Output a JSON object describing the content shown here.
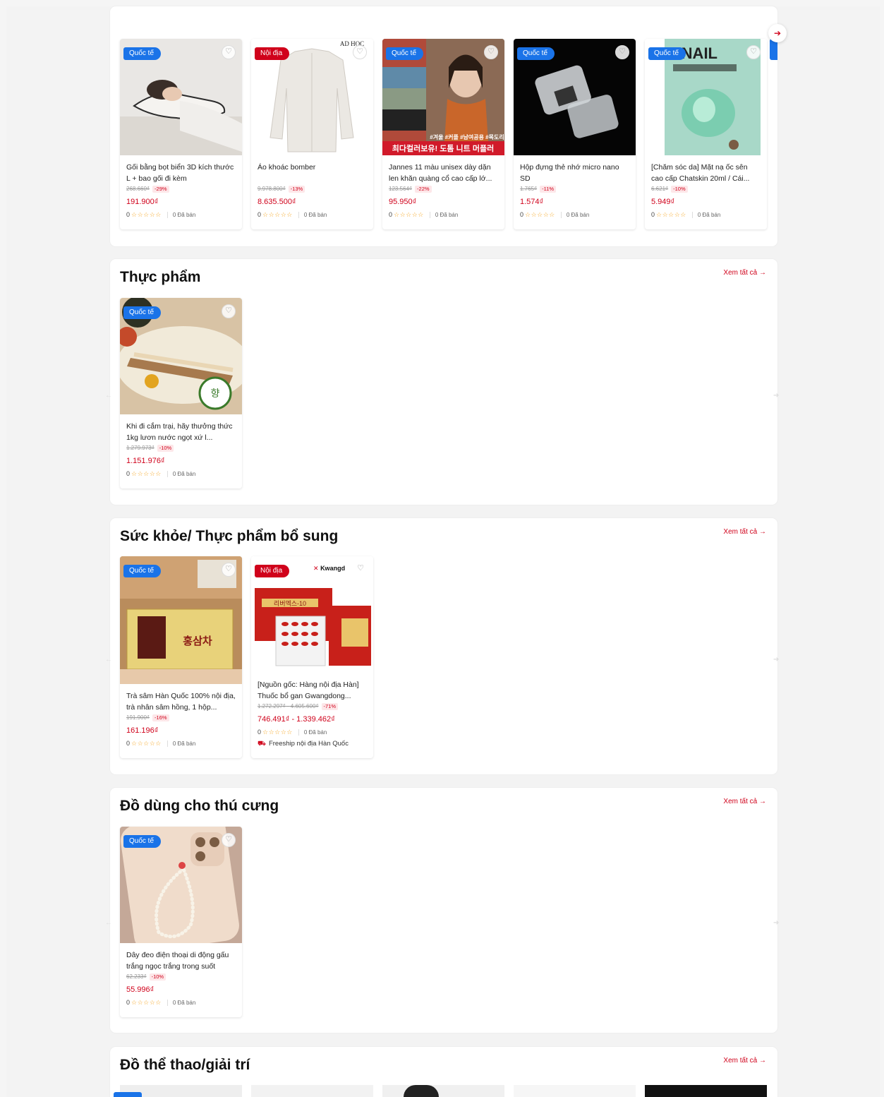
{
  "common": {
    "sold_label": "0 Đã bán",
    "rating_count": "0",
    "stars": "☆☆☆☆☆",
    "view_all": "Xem tất cả →",
    "badge_intl": "Quốc tế",
    "badge_local": "Nội địa",
    "next_arrow": "➔",
    "prev_arrow": "←",
    "heart_icon": "♡"
  },
  "top_section": {
    "products": [
      {
        "name": "Gối bằng bọt biển 3D kích thước L + bao gối đi kèm",
        "old_price": "268.660₫",
        "discount": "-29%",
        "price": "191.900₫",
        "badge": "Quốc tế"
      },
      {
        "name": "Áo khoác bomber",
        "old_price": "9.978.800₫",
        "discount": "-13%",
        "price": "8.635.500₫",
        "badge": "Nội địa"
      },
      {
        "name": "Jannes 11 màu unisex dày dặn len khăn quàng cổ cao cấp lớ...",
        "old_price": "123.564₫",
        "discount": "-22%",
        "price": "95.950₫",
        "badge": "Quốc tế"
      },
      {
        "name": "Hộp đựng thẻ nhớ micro nano SD",
        "old_price": "1.765₫",
        "discount": "-11%",
        "price": "1.574₫",
        "badge": "Quốc tế"
      },
      {
        "name": "[Chăm sóc da] Mặt nạ ốc sên cao cấp Chatskin 20ml / Cái...",
        "old_price": "6.621₫",
        "discount": "-10%",
        "price": "5.949₫",
        "badge": "Quốc tế"
      }
    ]
  },
  "food_section": {
    "title": "Thực phẩm",
    "products": [
      {
        "name": "Khi đi cắm trại, hãy thưởng thức 1kg lươn nước ngọt xứ l...",
        "old_price": "1.279.973₫",
        "discount": "-10%",
        "price": "1.151.976₫",
        "badge": "Quốc tế"
      }
    ]
  },
  "health_section": {
    "title": "Sức khỏe/ Thực phẩm bổ sung",
    "products": [
      {
        "name": "Trà sâm Hàn Quốc 100% nội địa, trà nhân sâm hồng, 1 hộp...",
        "old_price": "191.900₫",
        "discount": "-16%",
        "price": "161.196₫",
        "badge": "Quốc tế"
      },
      {
        "name": "[Nguồn gốc: Hàng nội địa Hàn] Thuốc bổ gan Gwangdong...",
        "old_price": "1.272.297₫ - 4.605.600₫",
        "discount": "-71%",
        "price": "746.491₫ - 1.339.462₫",
        "badge": "Nội địa",
        "brand": "Kwangd",
        "shipping": "Freeship nội địa Hàn Quốc",
        "img_text": "리버엑스-10"
      }
    ]
  },
  "pet_section": {
    "title": "Đồ dùng cho thú cưng",
    "products": [
      {
        "name": "Dây đeo điện thoại di động gấu trắng ngọc trắng trong suốt",
        "old_price": "62.233₫",
        "discount": "-10%",
        "price": "55.996₫",
        "badge": "Quốc tế"
      }
    ]
  },
  "sport_section": {
    "title": "Đồ thể thao/giải trí"
  },
  "image_texts": {
    "adhoc": "AD HOC",
    "snail": "SNAIL",
    "scarf_line1": "#겨울 #커플 #남여공용 #목도리",
    "scarf_line2": "최다컬러보유! 도톰 니트 머플러",
    "ginseng": "홍삼차"
  },
  "colors": {
    "accent": "#d0021b",
    "intl_badge": "#1a73e8",
    "local_badge": "#d0021b",
    "star": "#f5a623"
  }
}
